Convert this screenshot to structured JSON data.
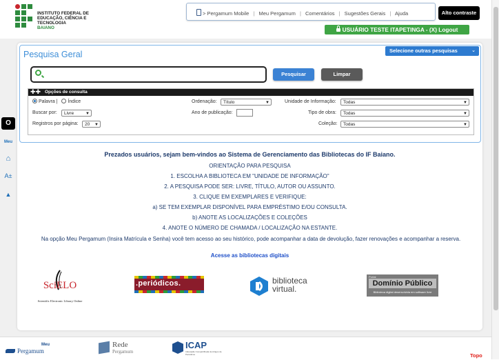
{
  "header": {
    "logo_line1": "INSTITUTO FEDERAL DE",
    "logo_line2": "EDUCAÇÃO, CIÊNCIA E TECNOLOGIA",
    "logo_line3": "BAIANO",
    "nav": {
      "mobile": "Pergamum Mobile",
      "mobile_prefix": ">",
      "meu": "Meu Pergamum",
      "comentarios": "Comentários",
      "sugestoes": "Sugestões Gerais",
      "ajuda": "Ajuda"
    },
    "contrast": "Alto contraste",
    "user_text": "USUÁRIO TESTE ITAPETINGA - (X) Logout"
  },
  "sidetools": {
    "contrast_o": "O",
    "meu_label": "Meu",
    "font_size": "A±"
  },
  "search": {
    "title": "Pesquisa Geral",
    "other_searches": "Selecione outras pesquisas",
    "query": "",
    "search_button": "Pesquisar",
    "clear_button": "Limpar"
  },
  "options": {
    "bar_label": "Opções de consulta",
    "radio_palavra": "Palavra",
    "radio_sep": "|",
    "radio_indice": "Índice",
    "buscar_label": "Buscar por:",
    "buscar_value": "Livre",
    "registros_label": "Registros por página:",
    "registros_value": "20",
    "ordenacao_label": "Ordenação:",
    "ordenacao_value": "Título",
    "ano_label": "Ano de publicação:",
    "unidade_label": "Unidade de Informação:",
    "unidade_value": "Todas",
    "tipo_label": "Tipo de obra:",
    "tipo_value": "Todas",
    "colecao_label": "Coleção:",
    "colecao_value": "Todas"
  },
  "welcome": {
    "title": "Prezados usuários, sejam bem-vindos ao Sistema de Gerenciamento das Bibliotecas do IF Baiano.",
    "l1": "ORIENTAÇÃO PARA PESQUISA",
    "l2": "1. ESCOLHA A BIBLIOTECA EM \"UNIDADE DE INFORMAÇÃO\"",
    "l3": "2. A PESQUISA PODE SER: LIVRE, TÍTULO, AUTOR OU ASSUNTO.",
    "l4": "3. CLIQUE EM EXEMPLARES E VERIFIQUE:",
    "l5": "a) SE TEM EXEMPLAR DISPONÍVEL PARA EMPRÉSTIMO E/OU CONSULTA.",
    "l6": "b) ANOTE AS LOCALIZAÇÕES E COLEÇÕES",
    "l7": "4. ANOTE O NÚMERO DE CHAMADA / LOCALIZAÇÃO NA ESTANTE.",
    "para": "Na opção Meu Pergamum (Insira Matrícula e Senha) você tem acesso ao seu histórico, pode acompanhar a data de devolução, fazer renovações e acompanhar a reserva.",
    "link": "Acesse as bibliotecas digitais"
  },
  "partners": {
    "scielo": "SciELO",
    "scielo_sub": "Scientific Electronic Library Online",
    "periodicos": ".periódicos.",
    "bv_line1": "biblioteca",
    "bv_line2": "virtual.",
    "dominio_small": "Portal",
    "dominio": "Domínio Público",
    "dominio_sub": "Biblioteca digital desenvolvida em software livre"
  },
  "footer": {
    "meu": "Meu",
    "pergamum": "Pergamum",
    "rede": "Rede",
    "rede_sub": "Pergamum",
    "icap": "ICAP",
    "icap_sub": "Indexação Compartilhada de Artigos de Periódicos",
    "topo": "Topo"
  },
  "colors": {
    "accent_blue": "#3d8ed8",
    "user_green": "#3fa544",
    "welcome_navy": "#1d3a6b",
    "periodicos_red": "#8a1c2b",
    "topo_red": "#e0201a"
  }
}
